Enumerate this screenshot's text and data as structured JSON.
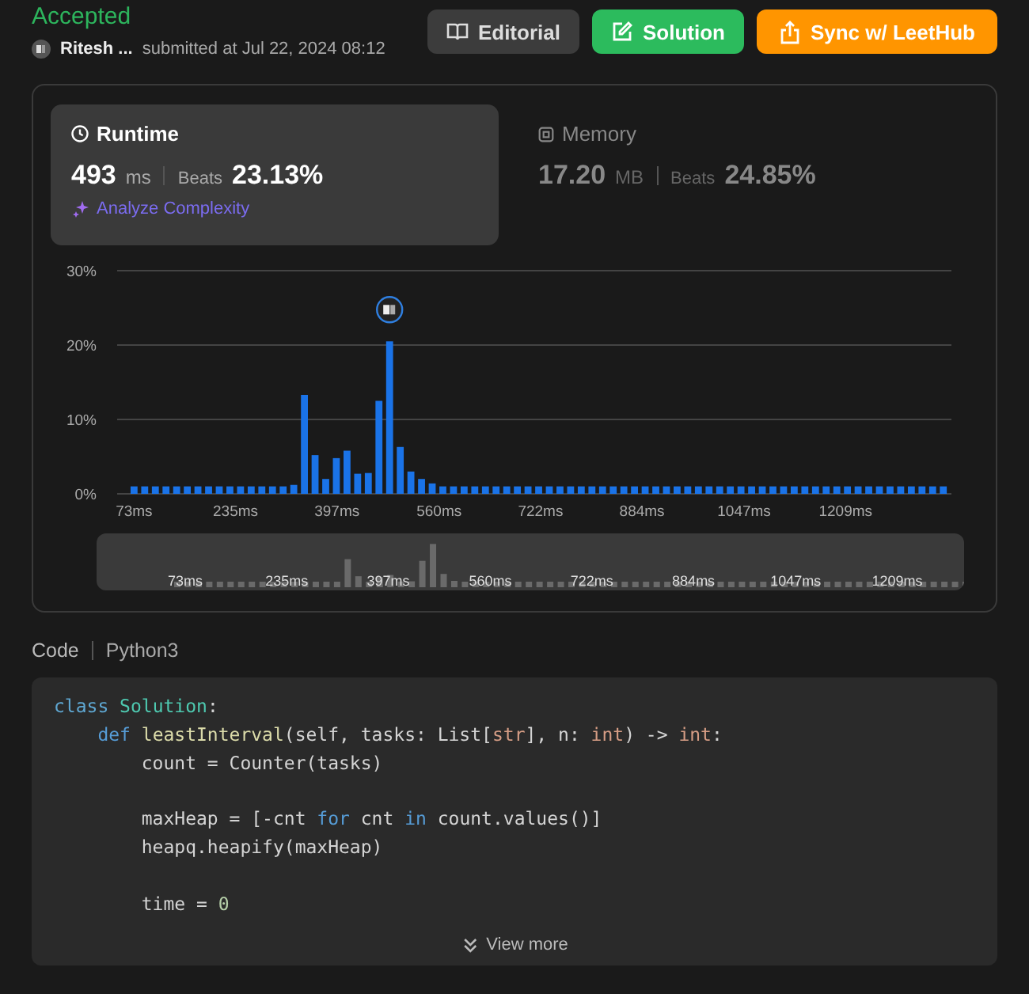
{
  "status": "Accepted",
  "author": {
    "name": "Ritesh ...",
    "submitted": "submitted at Jul 22, 2024 08:12"
  },
  "buttons": [
    {
      "label": "Editorial",
      "kind": "editorial"
    },
    {
      "label": "Solution",
      "kind": "solution"
    },
    {
      "label": "Sync w/ LeetHub",
      "kind": "sync"
    }
  ],
  "metrics": [
    {
      "kind": "runtime",
      "label": "Runtime",
      "value": "493",
      "unit": "ms",
      "beats_label": "Beats",
      "beats": "23.13%",
      "selected": true,
      "link": "Analyze Complexity"
    },
    {
      "kind": "memory",
      "label": "Memory",
      "value": "17.20",
      "unit": "MB",
      "beats_label": "Beats",
      "beats": "24.85%",
      "selected": false
    }
  ],
  "chart_data": {
    "type": "bar",
    "x": [
      73,
      90,
      107,
      124,
      141,
      158,
      175,
      192,
      209,
      226,
      243,
      260,
      277,
      294,
      311,
      328,
      345,
      362,
      379,
      396,
      413,
      430,
      447,
      464,
      481,
      498,
      515,
      532,
      549,
      566,
      583,
      600,
      617,
      634,
      651,
      668,
      685,
      702,
      719,
      736,
      753,
      770,
      787,
      804,
      821,
      838,
      855,
      872,
      889,
      906,
      923,
      940,
      957,
      974,
      991,
      1008,
      1025,
      1042,
      1059,
      1076,
      1093,
      1110,
      1127,
      1144,
      1161,
      1178,
      1195,
      1212,
      1229,
      1246,
      1263,
      1280,
      1297,
      1314,
      1331,
      1348,
      1365
    ],
    "series": [
      {
        "color": "#1a73e8",
        "values": [
          1,
          1,
          1,
          1,
          1,
          1,
          1,
          1,
          1,
          1,
          1,
          1,
          1,
          1,
          1,
          1.2,
          13.3,
          5.2,
          2,
          4.8,
          5.8,
          2.7,
          2.8,
          12.5,
          20.5,
          6.3,
          3,
          2,
          1.4,
          1,
          1,
          1,
          1,
          1,
          1,
          1,
          1,
          1,
          1,
          1,
          1,
          1,
          1,
          1,
          1,
          1,
          1,
          1,
          1,
          1,
          1,
          1,
          1,
          1,
          1,
          1,
          1,
          1,
          1,
          1,
          1,
          1,
          1,
          1,
          1,
          1,
          1,
          1,
          1,
          1,
          1,
          1,
          1,
          1,
          1,
          1,
          1
        ]
      }
    ],
    "xlim": [
      46,
      1378
    ],
    "ylim": [
      0,
      30
    ],
    "yticks": [
      {
        "value": 0,
        "label": "0%"
      },
      {
        "value": 10,
        "label": "10%"
      },
      {
        "value": 20,
        "label": "20%"
      },
      {
        "value": 30,
        "label": "30%"
      }
    ],
    "xticks": [
      {
        "value": 73,
        "label": "73ms"
      },
      {
        "value": 235,
        "label": "235ms"
      },
      {
        "value": 397,
        "label": "397ms"
      },
      {
        "value": 560,
        "label": "560ms"
      },
      {
        "value": 722,
        "label": "722ms"
      },
      {
        "value": 884,
        "label": "884ms"
      },
      {
        "value": 1047,
        "label": "1047ms"
      },
      {
        "value": 1209,
        "label": "1209ms"
      }
    ]
  },
  "overview": {
    "labels": [
      "73ms",
      "235ms",
      "397ms",
      "560ms",
      "722ms",
      "884ms",
      "1047ms",
      "1209ms"
    ]
  },
  "code": {
    "label": "Code",
    "language": "Python3",
    "lines": [
      {
        "kind": "code",
        "tokens": [
          {
            "t": "class",
            "kind": "keyword2"
          },
          {
            "t": " Solution",
            "kind": "class"
          },
          {
            "t": ":"
          }
        ]
      },
      {
        "kind": "code",
        "tokens": [
          {
            "t": "    def",
            "kind": "keyword"
          },
          {
            "t": " leastInterval",
            "kind": "function"
          },
          {
            "t": "(self, tasks: List["
          },
          {
            "t": "str",
            "kind": "type"
          },
          {
            "t": "], n: "
          },
          {
            "t": "int",
            "kind": "type"
          },
          {
            "t": ") -> "
          },
          {
            "t": "int",
            "kind": "type"
          },
          {
            "t": ":"
          }
        ]
      },
      {
        "kind": "code",
        "tokens": [
          {
            "t": "        count = Counter(tasks)"
          }
        ]
      },
      {
        "kind": "blank"
      },
      {
        "kind": "code",
        "tokens": [
          {
            "t": "        maxHeap = [-cnt "
          },
          {
            "t": "for",
            "kind": "keyword"
          },
          {
            "t": " cnt "
          },
          {
            "t": "in",
            "kind": "keyword"
          },
          {
            "t": " count.values()]"
          }
        ]
      },
      {
        "kind": "code",
        "tokens": [
          {
            "t": "        heapq.heapify(maxHeap)"
          }
        ]
      },
      {
        "kind": "blank"
      },
      {
        "kind": "code",
        "tokens": [
          {
            "t": "        time = "
          },
          {
            "t": "0",
            "kind": "number"
          }
        ]
      }
    ],
    "more": "View more"
  }
}
